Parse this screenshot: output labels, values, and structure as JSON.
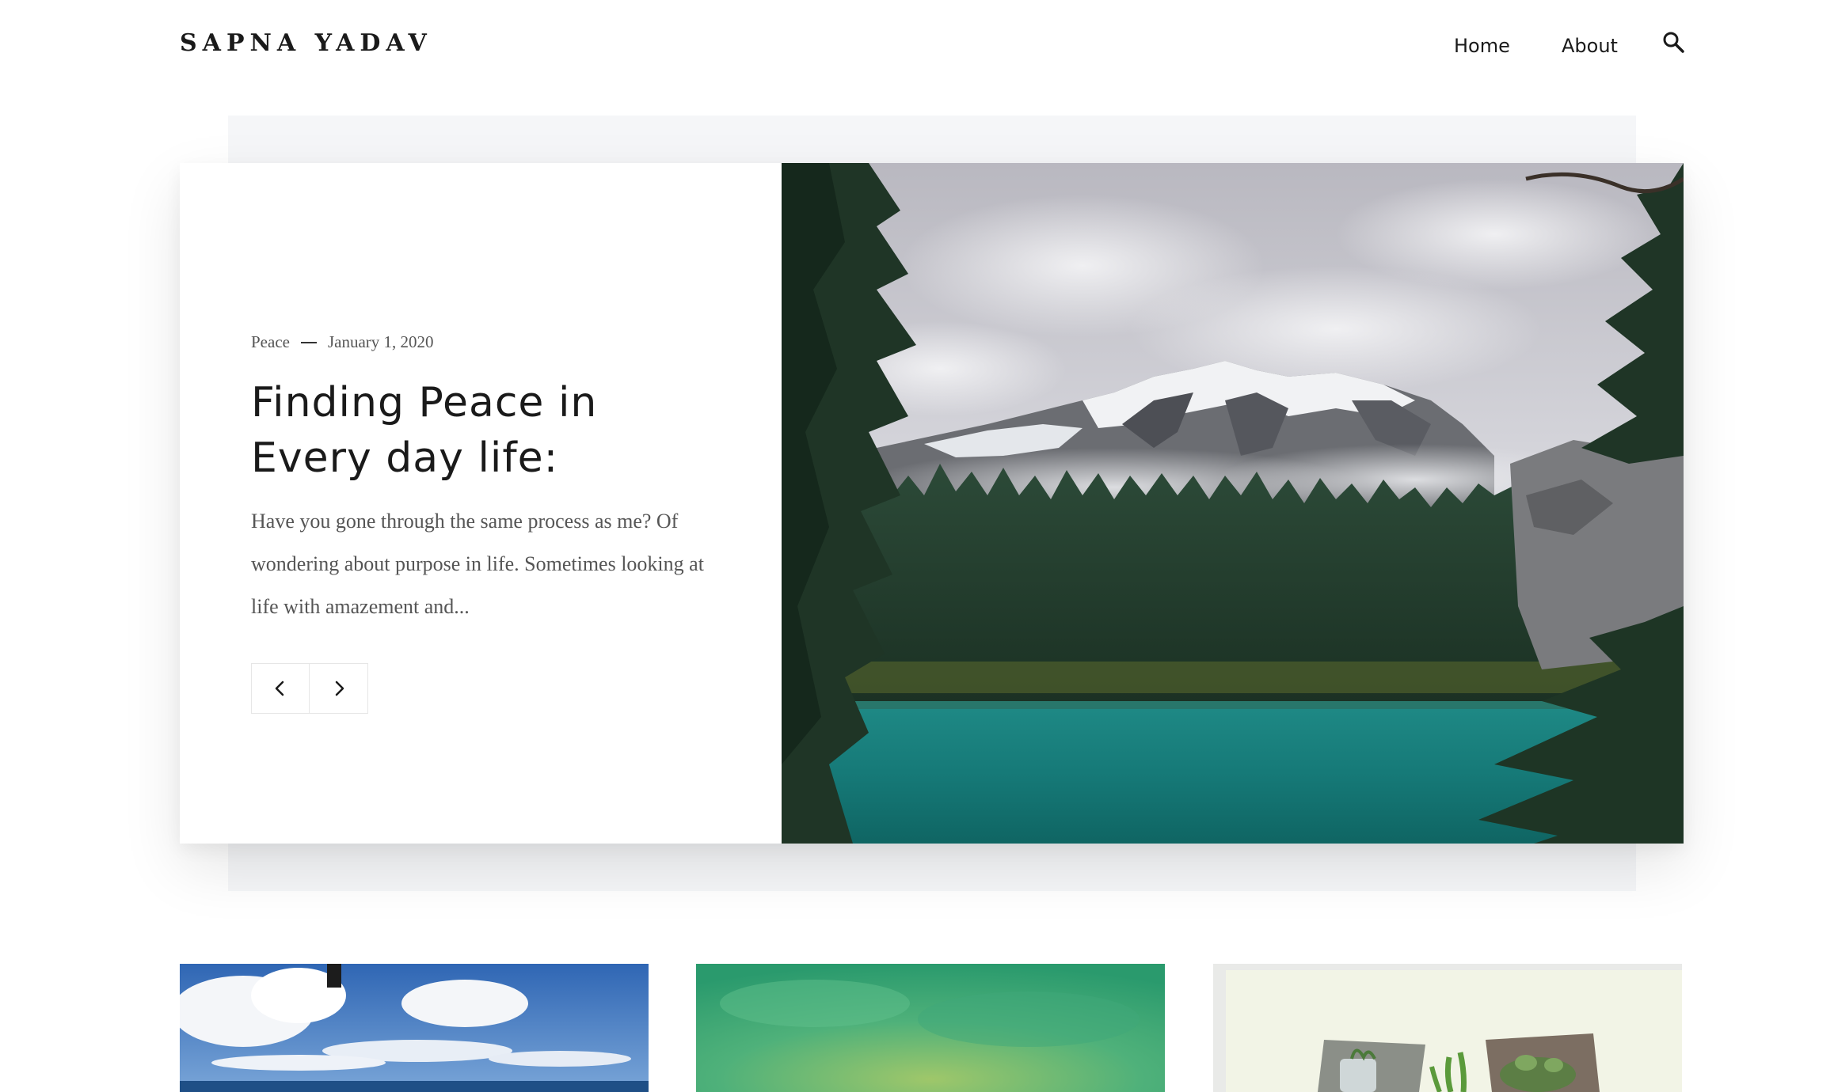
{
  "header": {
    "brand": "SAPNA YADAV",
    "nav": {
      "home": "Home",
      "about": "About"
    },
    "search_icon": "search-icon"
  },
  "hero": {
    "category": "Peace",
    "date": "January 1, 2020",
    "title_line1": "Finding Peace in",
    "title_line2": "Every day life:",
    "excerpt": "Have you gone through the same process as me? Of wondering about purpose in life. Sometimes looking at life with amazement and...",
    "prev_icon": "chevron-left-icon",
    "next_icon": "chevron-right-icon",
    "image_alt": "mountain-lake-forest-photo"
  },
  "cards": [
    {
      "image": "sky-clouds-ocean-photo"
    },
    {
      "image": "green-textured-background"
    },
    {
      "image": "potted-plants-collage"
    }
  ],
  "colors": {
    "text_dark": "#1a1a1a",
    "text_muted": "#555555",
    "hero_bg": "#f5f6f8",
    "border": "#e6e6e6"
  }
}
